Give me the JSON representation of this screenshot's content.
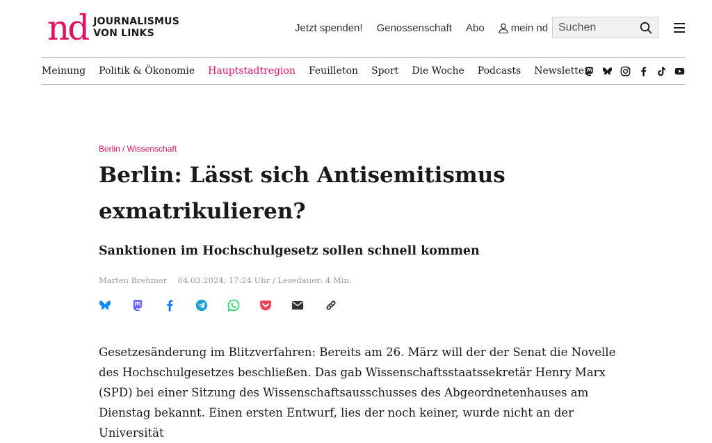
{
  "brand": {
    "logo_text": "nd",
    "claim_line1": "JOURNALISMUS",
    "claim_line2": "VON LINKS",
    "accent_color": "#e0115f"
  },
  "service_nav": {
    "donate": "Jetzt spenden!",
    "cooperative": "Genossenschaft",
    "subscription": "Abo",
    "account": "mein nd"
  },
  "search": {
    "placeholder": "Suchen"
  },
  "main_nav": {
    "items": [
      "Meinung",
      "Politik & Ökonomie",
      "Hauptstadtregion",
      "Feuilleton",
      "Sport",
      "Die Woche",
      "Podcasts",
      "Newsletter"
    ],
    "active": "Hauptstadtregion",
    "socials": [
      "mastodon-icon",
      "bluesky-icon",
      "instagram-icon",
      "facebook-icon",
      "tiktok-icon",
      "youtube-icon"
    ]
  },
  "article": {
    "kicker": "Berlin / Wissenschaft",
    "headline": "Berlin: Lässt sich Antisemitismus exmatrikulieren?",
    "subheadline": "Sanktionen im Hochschulgesetz sollen schnell kommen",
    "author": "Marten Brehmer",
    "meta": "04.03.2024, 17:24 Uhr / Lesedauer: 4 Min.",
    "share_icons": [
      "bluesky-icon",
      "mastodon-icon",
      "facebook-icon",
      "telegram-icon",
      "whatsapp-icon",
      "pocket-icon",
      "email-icon",
      "link-icon"
    ],
    "share_colors": {
      "bluesky": "#1185fe",
      "mastodon": "#6364ff",
      "facebook": "#1877f2",
      "telegram": "#229ed9",
      "whatsapp": "#25d366",
      "pocket": "#ef4056",
      "email": "#333333",
      "link": "#333333"
    },
    "body": "Gesetzesänderung im Blitzverfahren: Bereits am 26. März will der der Senat die Novelle des Hochschulgesetzes beschließen. Das gab Wissenschaftsstaatssekretär Henry Marx (SPD) bei einer Sitzung des Wissenschaftsausschusses des Abgeordnetenhauses am Dienstag bekannt. Einen ersten Entwurf, lies der noch keiner, wurde nicht an der Universität"
  }
}
